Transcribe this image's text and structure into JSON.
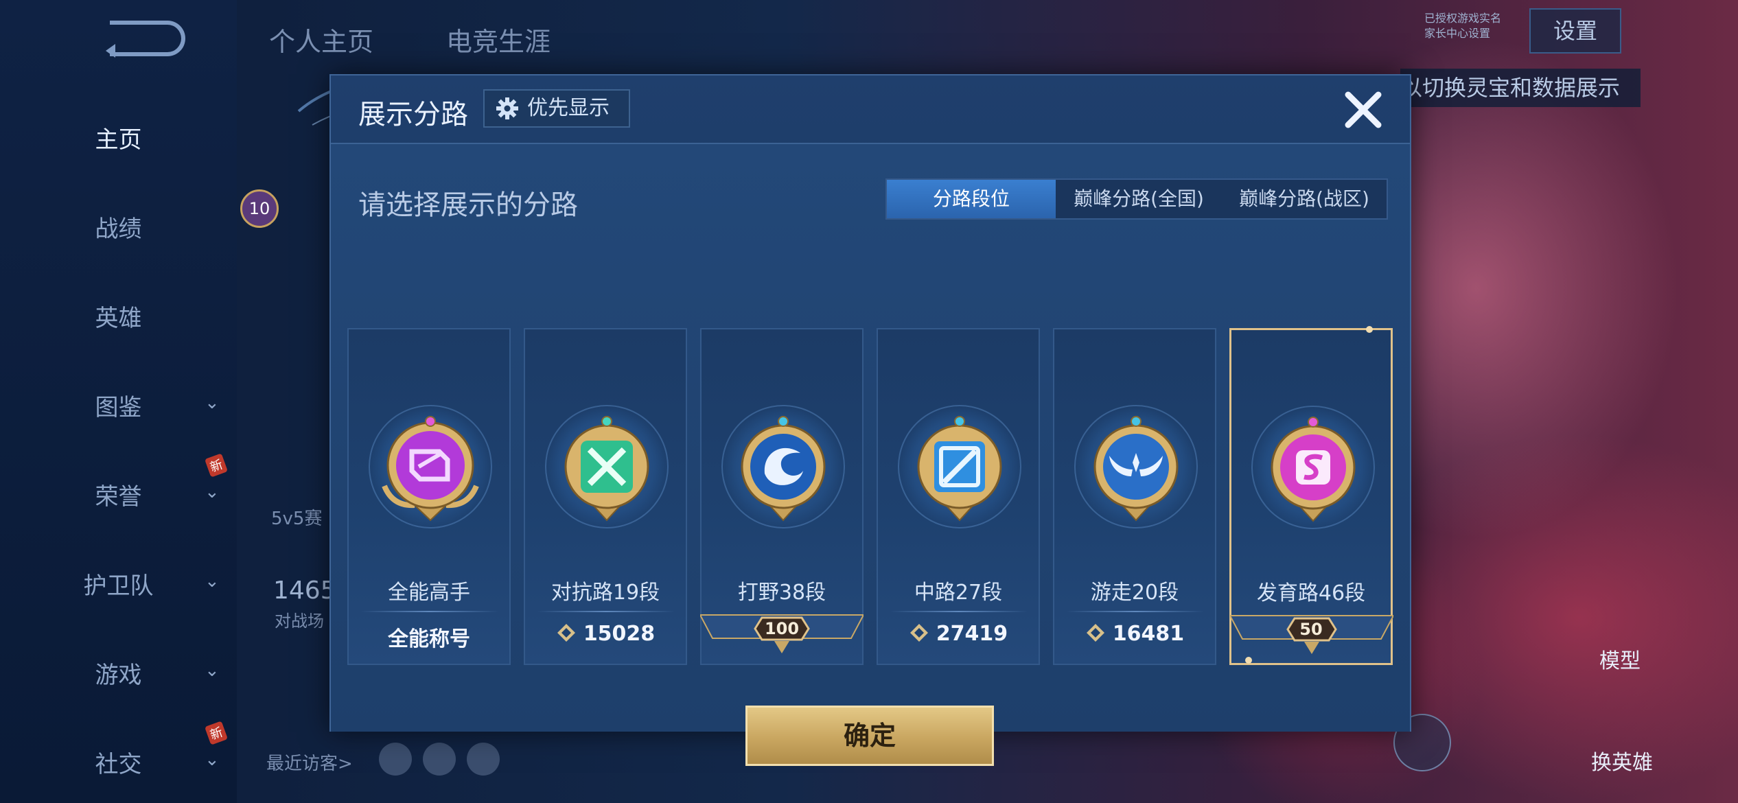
{
  "top_tabs": [
    "个人主页",
    "电竞生涯"
  ],
  "sidebar": {
    "items": [
      {
        "label": "主页",
        "active": true,
        "chevron": false,
        "new": false
      },
      {
        "label": "战绩",
        "active": false,
        "chevron": false,
        "new": false
      },
      {
        "label": "英雄",
        "active": false,
        "chevron": false,
        "new": false
      },
      {
        "label": "图鉴",
        "active": false,
        "chevron": true,
        "new": false
      },
      {
        "label": "荣誉",
        "active": false,
        "chevron": true,
        "new": true
      },
      {
        "label": "护卫队",
        "active": false,
        "chevron": true,
        "new": false
      },
      {
        "label": "游戏",
        "active": false,
        "chevron": true,
        "new": false
      },
      {
        "label": "社交",
        "active": false,
        "chevron": true,
        "new": true
      }
    ],
    "new_badge": "新"
  },
  "header": {
    "settings_label": "设置",
    "hint_text": "以切换灵宝和数据展示",
    "note_lines": [
      "已授权游戏实名",
      "家长中心设置"
    ]
  },
  "background": {
    "level": "10",
    "mode_text": "5v5赛",
    "score_text": "1465",
    "score_sub": "对战场",
    "recent_visitors": "最近访客>",
    "model_label": "模型",
    "switch_hero_label": "换英雄"
  },
  "dialog": {
    "title": "展示分路",
    "priority_label": "优先显示",
    "subtitle": "请选择展示的分路",
    "tabs": [
      {
        "label": "分路段位",
        "active": true
      },
      {
        "label": "巅峰分路(全国)",
        "active": false
      },
      {
        "label": "巅峰分路(战区)",
        "active": false
      }
    ],
    "cards": [
      {
        "name": "全能高手",
        "footer_text": "全能称号",
        "footer_type": "text",
        "selected": false,
        "emblem": "all-round-emblem-icon",
        "color": "#b23ad9"
      },
      {
        "name": "对抗路19段",
        "footer_text": "15028",
        "footer_type": "points",
        "selected": false,
        "emblem": "clash-lane-emblem-icon",
        "color": "#2fbf8e"
      },
      {
        "name": "打野38段",
        "footer_text": "100",
        "footer_type": "rank",
        "selected": false,
        "emblem": "jungle-emblem-icon",
        "color": "#2a7bd8"
      },
      {
        "name": "中路27段",
        "footer_text": "27419",
        "footer_type": "points",
        "selected": false,
        "emblem": "mid-lane-emblem-icon",
        "color": "#2f8fe0"
      },
      {
        "name": "游走20段",
        "footer_text": "16481",
        "footer_type": "points",
        "selected": false,
        "emblem": "roam-emblem-icon",
        "color": "#2a6fc8"
      },
      {
        "name": "发育路46段",
        "footer_text": "50",
        "footer_type": "rank",
        "selected": true,
        "emblem": "farm-lane-emblem-icon",
        "color": "#d63fc8"
      }
    ],
    "confirm_label": "确定"
  },
  "colors": {
    "gold": "#d9b873",
    "accent_blue": "#3a7fd0"
  }
}
